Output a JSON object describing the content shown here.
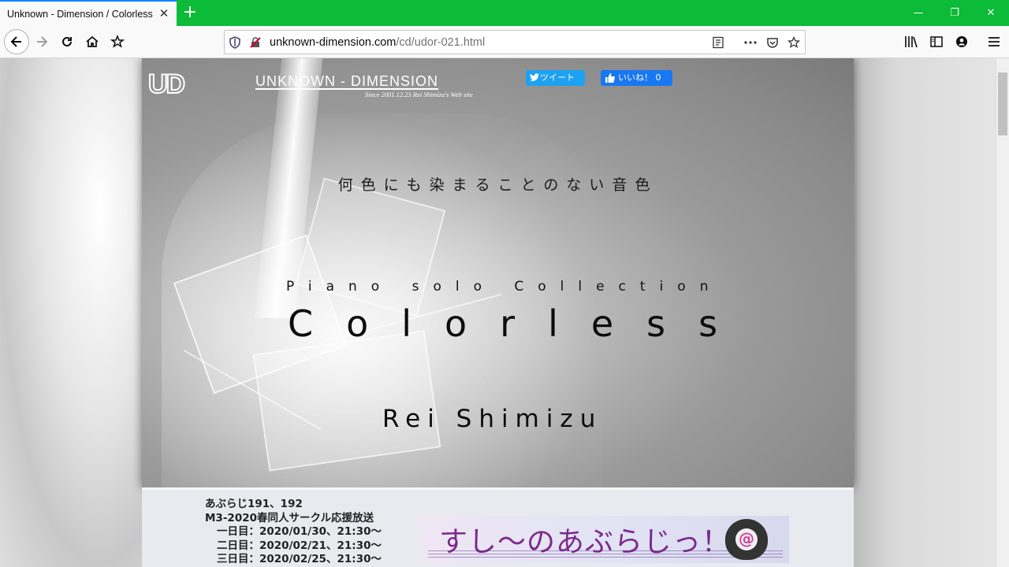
{
  "browser": {
    "tab_title": "Unknown - Dimension / Colorless",
    "url_domain": "unknown-dimension.com",
    "url_path": "/cd/udor-021.html",
    "accent_color": "#0cbb37"
  },
  "header": {
    "logo_mark": "UD",
    "logo_name": "UNKNOWN - DIMENSION",
    "logo_sub": "Since 2001.12.23 Rei Shimizu's Web site",
    "tweet_label": "ツイート",
    "like_label": "いいね！ 0"
  },
  "hero": {
    "tagline": "何色にも染まることのない音色",
    "series": "Piano solo Collection",
    "title": "Colorless",
    "artist": "Rei Shimizu"
  },
  "info": {
    "lines": [
      "あぶらじ191、192",
      "M3-2020春同人サークル応援放送",
      "一日目：2020/01/30、21:30～",
      "二日目：2020/02/21、21:30～",
      "三日目：2020/02/25、21:30～"
    ],
    "banner_text": "すし～のあぶらじっ！",
    "banner_at": "@"
  }
}
